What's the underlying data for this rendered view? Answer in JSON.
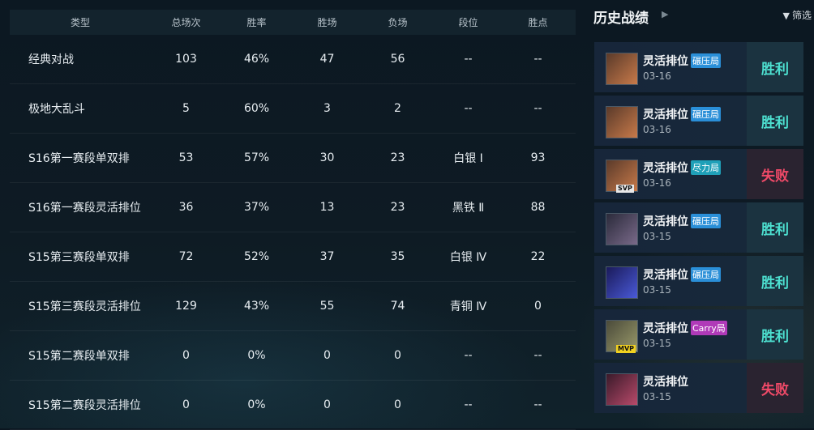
{
  "stats": {
    "headers": [
      "类型",
      "总场次",
      "胜率",
      "胜场",
      "负场",
      "段位",
      "胜点"
    ],
    "rows": [
      {
        "type": "经典对战",
        "total": "103",
        "rate": "46%",
        "wins": "47",
        "losses": "56",
        "rank": "--",
        "lp": "--"
      },
      {
        "type": "极地大乱斗",
        "total": "5",
        "rate": "60%",
        "wins": "3",
        "losses": "2",
        "rank": "--",
        "lp": "--"
      },
      {
        "type": "S16第一赛段单双排",
        "total": "53",
        "rate": "57%",
        "wins": "30",
        "losses": "23",
        "rank": "白银 Ⅰ",
        "lp": "93"
      },
      {
        "type": "S16第一赛段灵活排位",
        "total": "36",
        "rate": "37%",
        "wins": "13",
        "losses": "23",
        "rank": "黑铁 Ⅱ",
        "lp": "88"
      },
      {
        "type": "S15第三赛段单双排",
        "total": "72",
        "rate": "52%",
        "wins": "37",
        "losses": "35",
        "rank": "白银 Ⅳ",
        "lp": "22"
      },
      {
        "type": "S15第三赛段灵活排位",
        "total": "129",
        "rate": "43%",
        "wins": "55",
        "losses": "74",
        "rank": "青铜 Ⅳ",
        "lp": "0"
      },
      {
        "type": "S15第二赛段单双排",
        "total": "0",
        "rate": "0%",
        "wins": "0",
        "losses": "0",
        "rank": "--",
        "lp": "--"
      },
      {
        "type": "S15第二赛段灵活排位",
        "total": "0",
        "rate": "0%",
        "wins": "0",
        "losses": "0",
        "rank": "--",
        "lp": "--"
      }
    ]
  },
  "history": {
    "title": "历史战绩",
    "arrow_icon": "chevron-right-icon",
    "filter_label": "筛选",
    "filter_icon": "funnel-icon",
    "matches": [
      {
        "mode": "灵活排位",
        "tag": "碾压局",
        "tag_color": "#2a8fd8",
        "date": "03-16",
        "badge": "",
        "result": "胜利",
        "outcome": "win",
        "icon_colors": [
          "#5a3a2a",
          "#c87a4a"
        ]
      },
      {
        "mode": "灵活排位",
        "tag": "碾压局",
        "tag_color": "#2a8fd8",
        "date": "03-16",
        "badge": "",
        "result": "胜利",
        "outcome": "win",
        "icon_colors": [
          "#5a3a2a",
          "#c87a4a"
        ]
      },
      {
        "mode": "灵活排位",
        "tag": "尽力局",
        "tag_color": "#1fa0b8",
        "date": "03-16",
        "badge": "SVP",
        "result": "失败",
        "outcome": "loss",
        "icon_colors": [
          "#5a3a2a",
          "#c87a4a"
        ]
      },
      {
        "mode": "灵活排位",
        "tag": "碾压局",
        "tag_color": "#2a8fd8",
        "date": "03-15",
        "badge": "",
        "result": "胜利",
        "outcome": "win",
        "icon_colors": [
          "#2a2a3a",
          "#7a6a8a"
        ]
      },
      {
        "mode": "灵活排位",
        "tag": "碾压局",
        "tag_color": "#2a8fd8",
        "date": "03-15",
        "badge": "",
        "result": "胜利",
        "outcome": "win",
        "icon_colors": [
          "#1a1a5a",
          "#4a5ad8"
        ]
      },
      {
        "mode": "灵活排位",
        "tag": "Carry局",
        "tag_color": "#b03ab8",
        "date": "03-15",
        "badge": "MVP",
        "result": "胜利",
        "outcome": "win",
        "icon_colors": [
          "#4a4a3a",
          "#9a9a6a"
        ]
      },
      {
        "mode": "灵活排位",
        "tag": "",
        "tag_color": "",
        "date": "03-15",
        "badge": "",
        "result": "失败",
        "outcome": "loss",
        "icon_colors": [
          "#3a1a2a",
          "#b84a6a"
        ]
      }
    ]
  }
}
